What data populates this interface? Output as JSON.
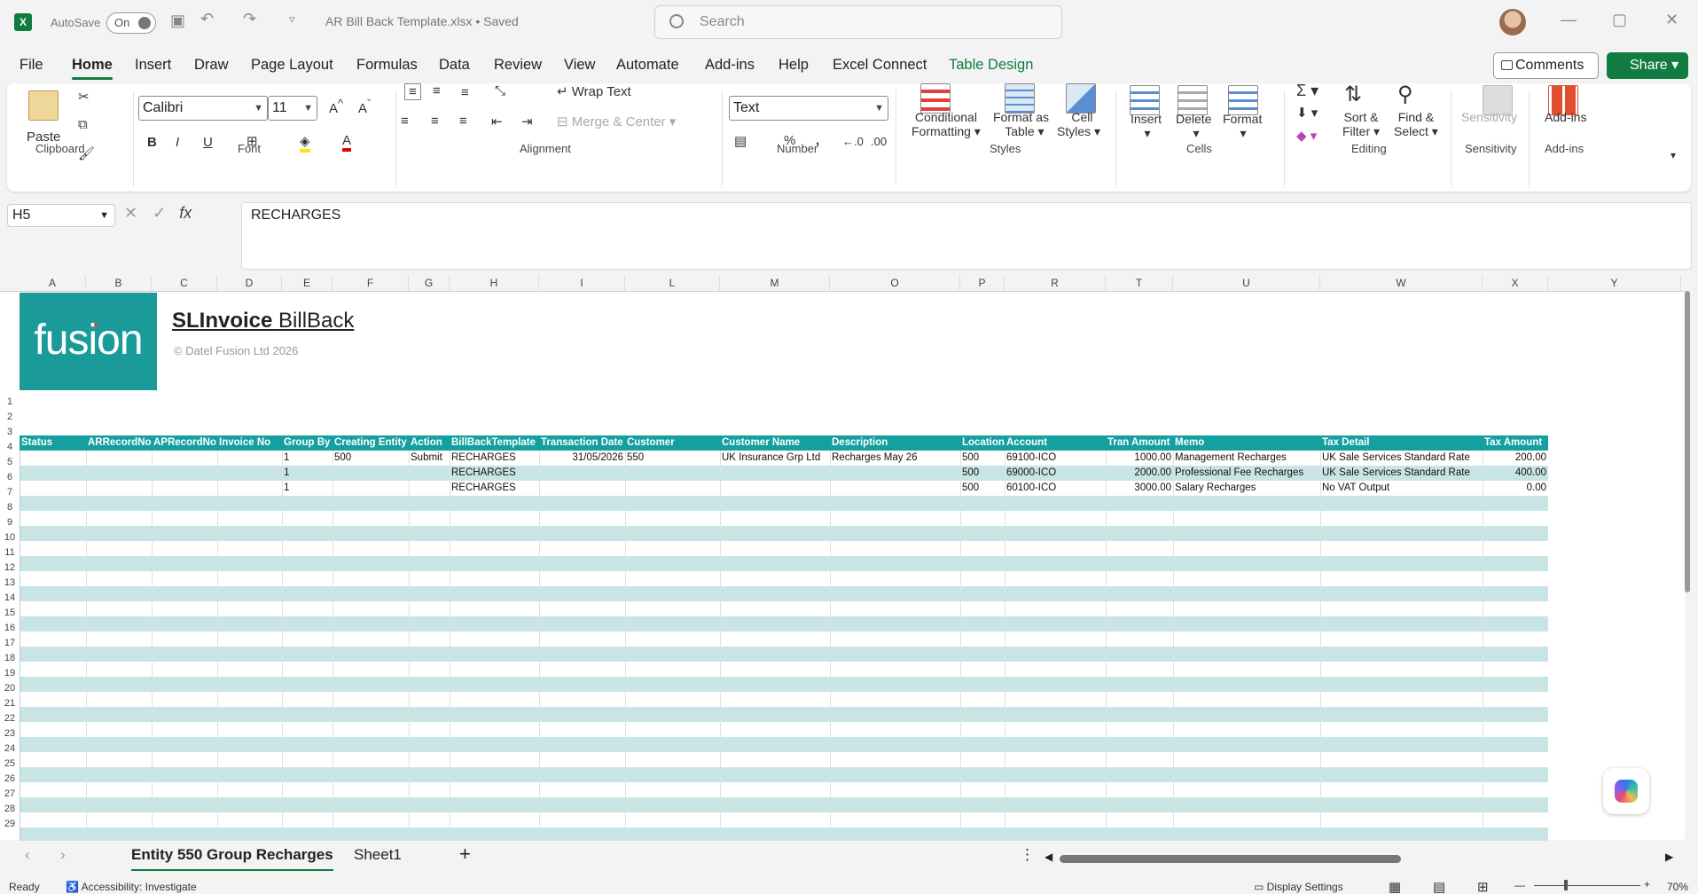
{
  "titlebar": {
    "autosave_label": "AutoSave",
    "autosave_state": "On",
    "doc_title": "AR Bill Back Template.xlsx • Saved",
    "search_placeholder": "Search"
  },
  "menu": [
    "File",
    "Home",
    "Insert",
    "Draw",
    "Page Layout",
    "Formulas",
    "Data",
    "Review",
    "View",
    "Automate",
    "Add-ins",
    "Help",
    "Excel Connect",
    "Table Design"
  ],
  "comments_label": "Comments",
  "share_label": "Share",
  "ribbon": {
    "clipboard": {
      "paste": "Paste",
      "group": "Clipboard"
    },
    "font": {
      "name": "Calibri",
      "size": "11",
      "group": "Font"
    },
    "alignment": {
      "wrap": "Wrap Text",
      "merge": "Merge & Center",
      "group": "Alignment"
    },
    "number": {
      "format": "Text",
      "group": "Number"
    },
    "styles": {
      "cond1": "Conditional",
      "cond2": "Formatting",
      "fmt1": "Format as",
      "fmt2": "Table",
      "cell1": "Cell",
      "cell2": "Styles",
      "group": "Styles"
    },
    "cells": {
      "insert": "Insert",
      "delete": "Delete",
      "format": "Format",
      "group": "Cells"
    },
    "editing": {
      "sort1": "Sort &",
      "sort2": "Filter",
      "find1": "Find &",
      "find2": "Select",
      "group": "Editing"
    },
    "sensitivity": {
      "label": "Sensitivity",
      "group": "Sensitivity"
    },
    "addins": {
      "label": "Add-ins",
      "group": "Add-ins"
    }
  },
  "namebox": "H5",
  "formula": "RECHARGES",
  "columns": [
    "A",
    "B",
    "C",
    "D",
    "E",
    "F",
    "G",
    "H",
    "I",
    "L",
    "M",
    "O",
    "P",
    "R",
    "T",
    "U",
    "W",
    "X",
    "Y"
  ],
  "banner": {
    "logo": "fusion",
    "title_bold": "SLInvoice",
    "title_rest": " BillBack",
    "copyright": "© Datel Fusion Ltd 2026"
  },
  "table_headers": [
    "Status",
    "ARRecordNo",
    "APRecordNo",
    "Invoice No",
    "Group By",
    "Creating Entity",
    "Action",
    "BillBackTemplate",
    "Transaction Date",
    "Customer",
    "Customer Name",
    "Description",
    "Location",
    "Account",
    "Tran Amount",
    "Memo",
    "Tax Detail",
    "Tax Amount"
  ],
  "rows": [
    [
      "",
      "",
      "",
      "",
      "1",
      "500",
      "Submit",
      "RECHARGES",
      "31/05/2026",
      "550",
      "UK Insurance Grp Ltd",
      "Recharges May 26",
      "500",
      "69100-ICO",
      "1000.00",
      "Management Recharges",
      "UK Sale Services Standard Rate",
      "200.00"
    ],
    [
      "",
      "",
      "",
      "",
      "1",
      "",
      "",
      "RECHARGES",
      "",
      "",
      "",
      "",
      "500",
      "69000-ICO",
      "2000.00",
      "Professional Fee Recharges",
      "UK Sale Services Standard Rate",
      "400.00"
    ],
    [
      "",
      "",
      "",
      "",
      "1",
      "",
      "",
      "RECHARGES",
      "",
      "",
      "",
      "",
      "500",
      "60100-ICO",
      "3000.00",
      "Salary Recharges",
      "No VAT Output",
      "0.00"
    ]
  ],
  "row_numbers": [
    "1",
    "2",
    "3",
    "4",
    "5",
    "6",
    "7",
    "8",
    "9",
    "10",
    "11",
    "12",
    "13",
    "14",
    "15",
    "16",
    "17",
    "18",
    "19",
    "20",
    "21",
    "22",
    "23",
    "24",
    "25",
    "26",
    "27",
    "28",
    "29"
  ],
  "sheets": [
    "Entity 550 Group Recharges",
    "Sheet1"
  ],
  "status": {
    "ready": "Ready",
    "accessibility": "Accessibility: Investigate",
    "display": "Display Settings",
    "zoom": "70%"
  }
}
